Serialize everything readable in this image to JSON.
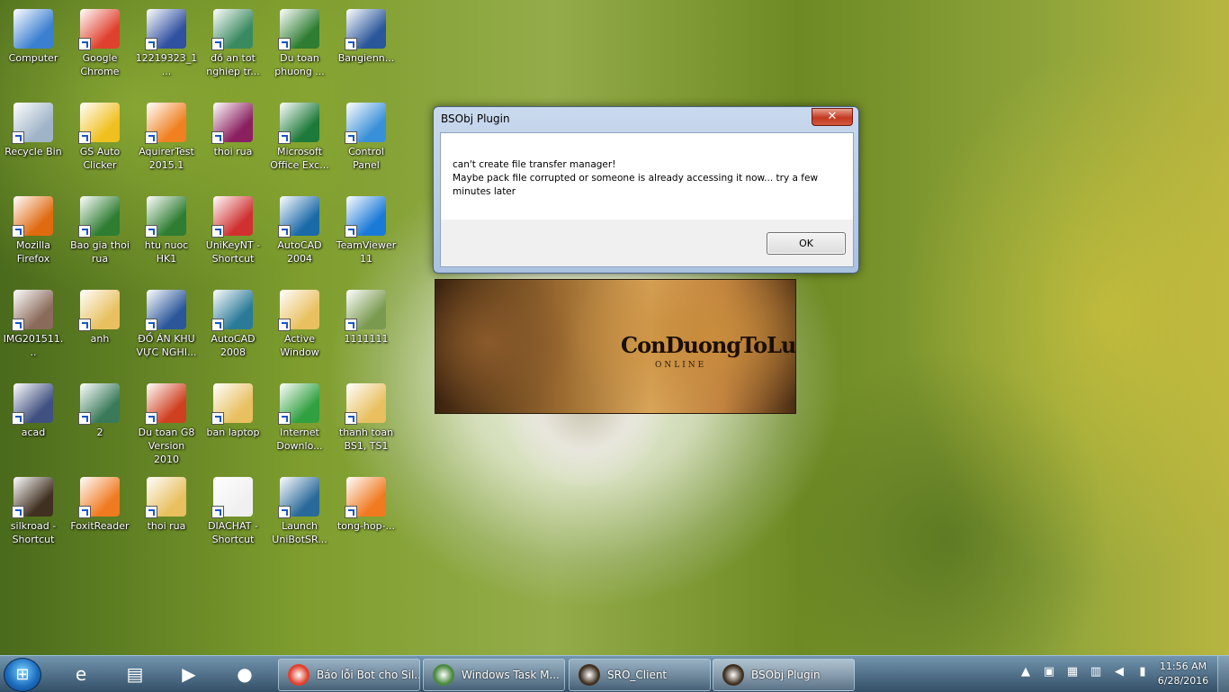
{
  "desktop": {
    "icons": [
      {
        "label": "Computer",
        "icon": "computer-icon",
        "color": "#3a7fd0"
      },
      {
        "label": "Google Chrome",
        "icon": "chrome-icon",
        "color": "#e0412e"
      },
      {
        "label": "12219323_1...",
        "icon": "image-file-icon",
        "color": "#3050a0"
      },
      {
        "label": "đồ an tot nghiep tr...",
        "icon": "image-file-icon",
        "color": "#3a8a60"
      },
      {
        "label": "Du toan phuong ...",
        "icon": "excel-file-icon",
        "color": "#2e7d32"
      },
      {
        "label": "Bangienn...",
        "icon": "word-file-icon",
        "color": "#2b579a"
      },
      {
        "label": "Recycle Bin",
        "icon": "recycle-bin-icon",
        "color": "#a0b4c8"
      },
      {
        "label": "GS Auto Clicker",
        "icon": "star-icon",
        "color": "#f0c020"
      },
      {
        "label": "AquirerTest 2015.1",
        "icon": "app-icon",
        "color": "#f08020"
      },
      {
        "label": "thoi rua",
        "icon": "winrar-icon",
        "color": "#8a2060"
      },
      {
        "label": "Microsoft Office Exc...",
        "icon": "excel-icon",
        "color": "#1e7a3a"
      },
      {
        "label": "Control Panel",
        "icon": "control-panel-icon",
        "color": "#3a90d8"
      },
      {
        "label": "Mozilla Firefox",
        "icon": "firefox-icon",
        "color": "#e06a10"
      },
      {
        "label": "Bao gia thoi rua",
        "icon": "excel-file-icon",
        "color": "#2e7d32"
      },
      {
        "label": "htu nuoc HK1",
        "icon": "excel-file-icon",
        "color": "#2e7d32"
      },
      {
        "label": "UniKeyNT - Shortcut",
        "icon": "unikey-icon",
        "color": "#d03030"
      },
      {
        "label": "AutoCAD 2004",
        "icon": "autocad-icon",
        "color": "#1a6aa8"
      },
      {
        "label": "TeamViewer 11",
        "icon": "teamviewer-icon",
        "color": "#1a7ad8"
      },
      {
        "label": "IMG201511...",
        "icon": "photo-icon",
        "color": "#8a6a5a"
      },
      {
        "label": "anh",
        "icon": "folder-icon",
        "color": "#e8c060"
      },
      {
        "label": "ĐỒ ÁN KHU VỰC NGHI...",
        "icon": "word-file-icon",
        "color": "#2b579a"
      },
      {
        "label": "AutoCAD 2008",
        "icon": "autocad-icon",
        "color": "#2a7a98"
      },
      {
        "label": "Active Window",
        "icon": "folder-icon",
        "color": "#e8c060"
      },
      {
        "label": "1111111",
        "icon": "photo-icon",
        "color": "#7a9a50"
      },
      {
        "label": "acad",
        "icon": "lisp-file-icon",
        "color": "#405080"
      },
      {
        "label": "2",
        "icon": "photo-icon",
        "color": "#3a7a5a"
      },
      {
        "label": "Du toan G8 Version 2010",
        "icon": "dutoan-icon",
        "color": "#d04020"
      },
      {
        "label": "ban laptop",
        "icon": "folder-icon",
        "color": "#e8c060"
      },
      {
        "label": "Internet Downlo...",
        "icon": "idm-icon",
        "color": "#30a040"
      },
      {
        "label": "thanh toan BS1, TS1",
        "icon": "folder-icon",
        "color": "#e8c060"
      },
      {
        "label": "silkroad - Shortcut",
        "icon": "silkroad-icon",
        "color": "#403020"
      },
      {
        "label": "FoxitReader",
        "icon": "foxit-icon",
        "color": "#f07a20"
      },
      {
        "label": "thoi rua",
        "icon": "folder-icon",
        "color": "#e8c060"
      },
      {
        "label": "DIACHAT - Shortcut",
        "icon": "file-icon",
        "color": "#f0f0f0"
      },
      {
        "label": "Launch UniBotSR...",
        "icon": "unibot-icon",
        "color": "#2a6a9a"
      },
      {
        "label": "tong-hop-...",
        "icon": "pdf-file-icon",
        "color": "#f07a20"
      }
    ]
  },
  "dialog": {
    "title": "BSObj Plugin",
    "close": "✕",
    "message_line1": "can't create file transfer manager!",
    "message_line2": "Maybe pack file corrupted or someone is already accessing it now... try a few minutes later",
    "ok_label": "OK"
  },
  "banner": {
    "logo": "ConDuongToLua",
    "subtitle": "ONLINE"
  },
  "taskbar": {
    "start_glyph": "⊞",
    "pinned": [
      {
        "name": "ie",
        "glyph": "e"
      },
      {
        "name": "explorer",
        "glyph": "▤"
      },
      {
        "name": "media-player",
        "glyph": "▶"
      },
      {
        "name": "firefox",
        "glyph": "●"
      }
    ],
    "tasks": [
      {
        "label": "Báo lỗi Bot cho Sil...",
        "icon_color": "#e0412e"
      },
      {
        "label": "Windows Task M...",
        "icon_color": "#4a8a40"
      },
      {
        "label": "SRO_Client",
        "icon_color": "#403020"
      },
      {
        "label": "BSObj Plugin",
        "icon_color": "#403020"
      }
    ],
    "tray_icons": [
      "▲",
      "▣",
      "▦",
      "▥",
      "◀",
      "▮"
    ],
    "time": "11:56 AM",
    "date": "6/28/2016"
  }
}
